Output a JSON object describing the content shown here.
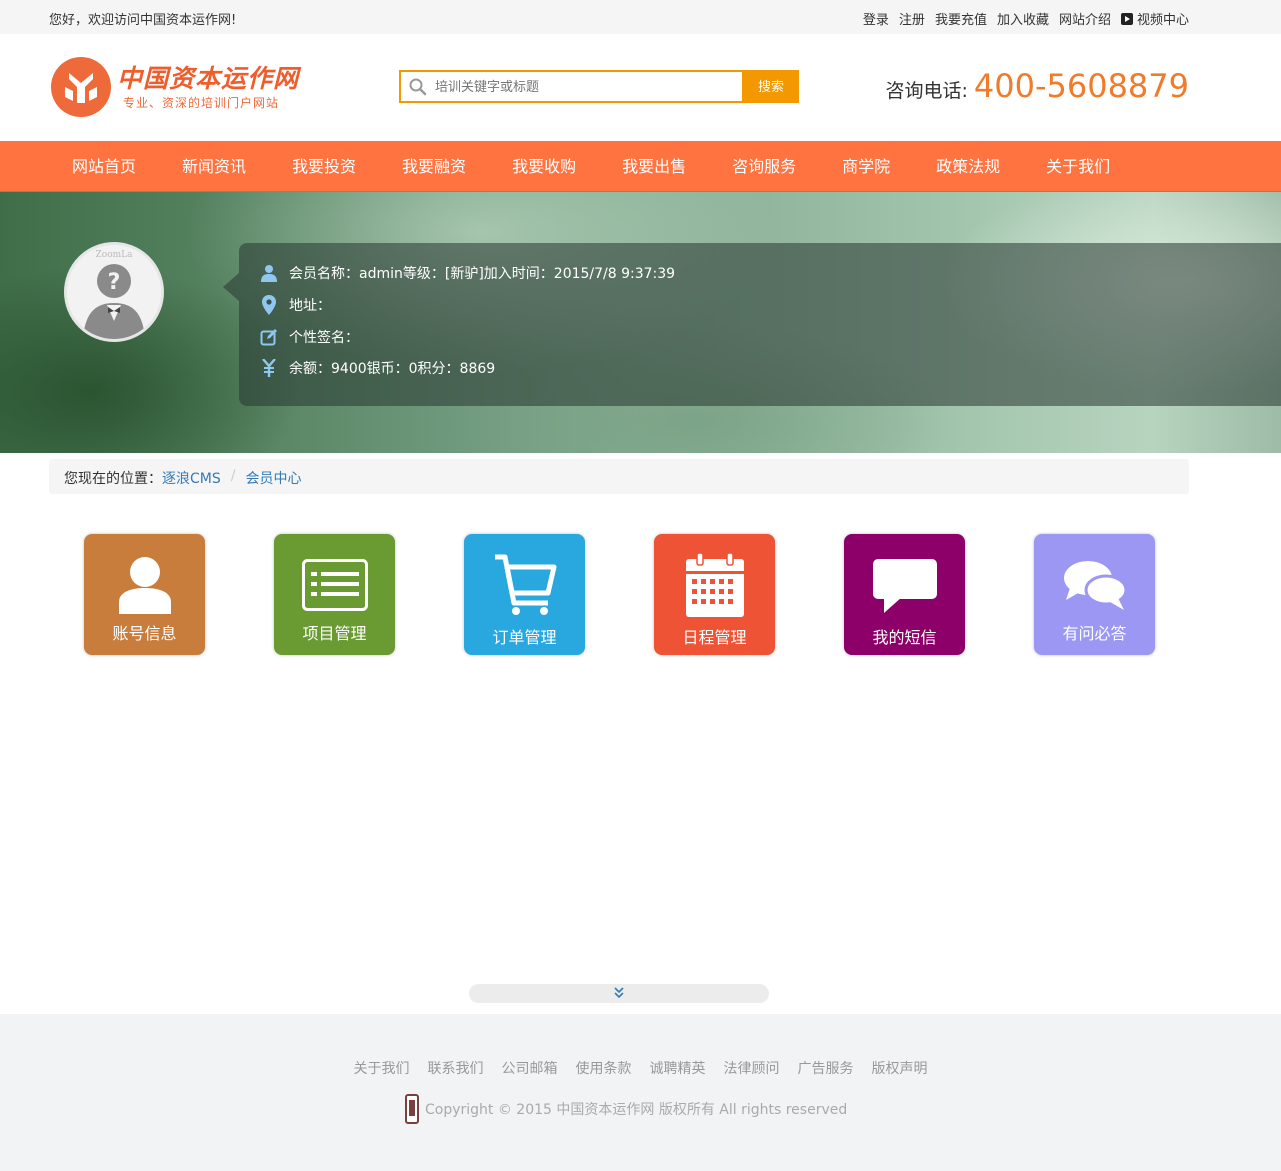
{
  "topbar": {
    "welcome": "您好，欢迎访问中国资本运作网!",
    "links": [
      "登录",
      "注册",
      "我要充值",
      "加入收藏",
      "网站介绍"
    ],
    "video": "视频中心"
  },
  "header": {
    "logo_title": "中国资本运作网",
    "logo_sub": "专业、资深的培训门户网站",
    "search_placeholder": "培训关键字或标题",
    "search_button": "搜索",
    "phone_label": "咨询电话:",
    "phone_number": "400-5608879",
    "accent": "#f39800",
    "phone_color": "#f07b2a"
  },
  "nav": {
    "color": "#ff7340",
    "items": [
      "网站首页",
      "新闻资讯",
      "我要投资",
      "我要融资",
      "我要收购",
      "我要出售",
      "咨询服务",
      "商学院",
      "政策法规",
      "关于我们"
    ]
  },
  "profile": {
    "avatar_text": "ZoomLa",
    "line1": "会员名称：admin等级：[新驴]加入时间：2015/7/8 9:37:39",
    "line2": "地址：",
    "line3": "个性签名：",
    "line4": "余额：9400银币：0积分：8869"
  },
  "breadcrumb": {
    "label": "您现在的位置：",
    "links": [
      "逐浪CMS",
      "会员中心"
    ],
    "separator": "/"
  },
  "tiles": [
    {
      "label": "账号信息",
      "icon": "user-icon",
      "color": "#c97d3d"
    },
    {
      "label": "项目管理",
      "icon": "list-icon",
      "color": "#6a9a32"
    },
    {
      "label": "订单管理",
      "icon": "cart-icon",
      "color": "#29a8e0"
    },
    {
      "label": "日程管理",
      "icon": "calendar-icon",
      "color": "#ef5335"
    },
    {
      "label": "我的短信",
      "icon": "message-icon",
      "color": "#8e0069"
    },
    {
      "label": "有问必答",
      "icon": "chat-icon",
      "color": "#9b97f3"
    }
  ],
  "footer": {
    "links": [
      "关于我们",
      "联系我们",
      "公司邮箱",
      "使用条款",
      "诚聘精英",
      "法律顾问",
      "广告服务",
      "版权声明"
    ],
    "copyright": "Copyright © 2015 中国资本运作网 版权所有 All rights reserved"
  }
}
